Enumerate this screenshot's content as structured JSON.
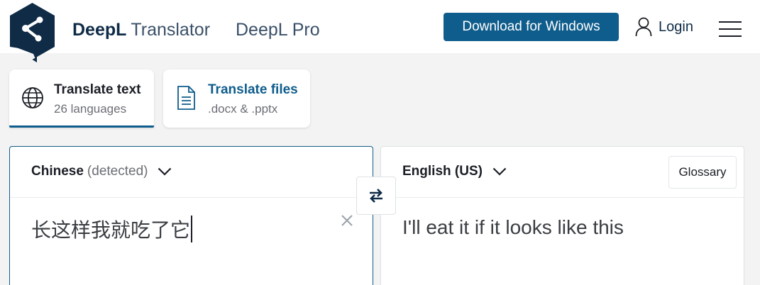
{
  "header": {
    "brand_name": "DeepL",
    "brand_sub": "Translator",
    "pro_link": "DeepL Pro",
    "download_button": "Download for Windows",
    "login": "Login",
    "icons": {
      "logo": "deepl-logo",
      "login": "user-icon",
      "menu": "hamburger-menu-icon"
    },
    "colors": {
      "navy": "#0f2b46",
      "accent": "#0f5d8c"
    }
  },
  "tabs": [
    {
      "title": "Translate text",
      "subtitle": "26 languages",
      "icon": "globe-icon",
      "active": true
    },
    {
      "title": "Translate files",
      "subtitle": ".docx & .pptx",
      "icon": "document-icon",
      "active": false
    }
  ],
  "source": {
    "language": "Chinese",
    "detected_label": "(detected)",
    "text": "长这样我就吃了它"
  },
  "target": {
    "language": "English (US)",
    "text": "I'll eat it if it looks like this",
    "glossary_button": "Glossary"
  }
}
